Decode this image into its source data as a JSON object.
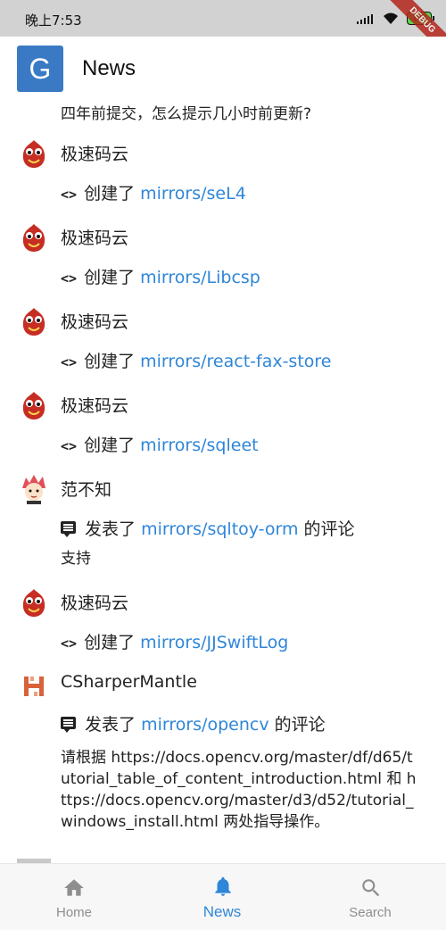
{
  "status_bar": {
    "time": "晚上7:53",
    "battery": "100",
    "debug_label": "DEBUG"
  },
  "app_bar": {
    "logo_letter": "G",
    "title": "News"
  },
  "feed": {
    "top_comment": "四年前提交，怎么提示几小时前更新?",
    "events": [
      {
        "user": "极速码云",
        "verb": "创建了",
        "repo": "mirrors/seL4",
        "suffix": "",
        "icon": "code-icon",
        "avatar": "mayun-mascot-avatar"
      },
      {
        "user": "极速码云",
        "verb": "创建了",
        "repo": "mirrors/Libcsp",
        "suffix": "",
        "icon": "code-icon",
        "avatar": "mayun-mascot-avatar"
      },
      {
        "user": "极速码云",
        "verb": "创建了",
        "repo": "mirrors/react-fax-store",
        "suffix": "",
        "icon": "code-icon",
        "avatar": "mayun-mascot-avatar"
      },
      {
        "user": "极速码云",
        "verb": "创建了",
        "repo": "mirrors/sqleet",
        "suffix": "",
        "icon": "code-icon",
        "avatar": "mayun-mascot-avatar"
      },
      {
        "user": "范不知",
        "verb": "发表了",
        "repo": "mirrors/sqltoy-orm",
        "suffix": "的评论",
        "icon": "comment-icon",
        "avatar": "anime-avatar",
        "comment": "支持"
      },
      {
        "user": "极速码云",
        "verb": "创建了",
        "repo": "mirrors/JJSwiftLog",
        "suffix": "",
        "icon": "code-icon",
        "avatar": "mayun-mascot-avatar"
      },
      {
        "user": "CSharperMantle",
        "verb": "发表了",
        "repo": "mirrors/opencv",
        "suffix": "的评论",
        "icon": "comment-icon",
        "avatar": "pixel-avatar",
        "comment": "请根据 https://docs.opencv.org/master/df/d65/tutorial_table_of_content_introduction.html 和 https://docs.opencv.org/master/d3/d52/tutorial_windows_install.html 两处指导操作。"
      }
    ]
  },
  "bottom_nav": {
    "items": [
      {
        "label": "Home",
        "icon": "home-icon",
        "active": false
      },
      {
        "label": "News",
        "icon": "bell-icon",
        "active": true
      },
      {
        "label": "Search",
        "icon": "search-icon",
        "active": false
      }
    ]
  },
  "colors": {
    "accent": "#2f86d8",
    "logo_bg": "#3a7ac4",
    "inactive": "#8e8e8e"
  }
}
